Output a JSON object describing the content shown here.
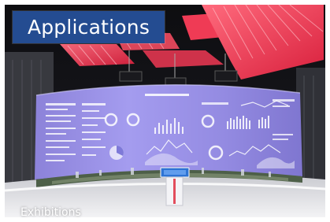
{
  "banner": {
    "title": "Applications",
    "color": "#244c91"
  },
  "caption": {
    "text": "Exhibitions"
  },
  "photo": {
    "subject": "exhibition-hall",
    "accent_color": "#e8364a",
    "screen_color": "#7e79d8"
  }
}
